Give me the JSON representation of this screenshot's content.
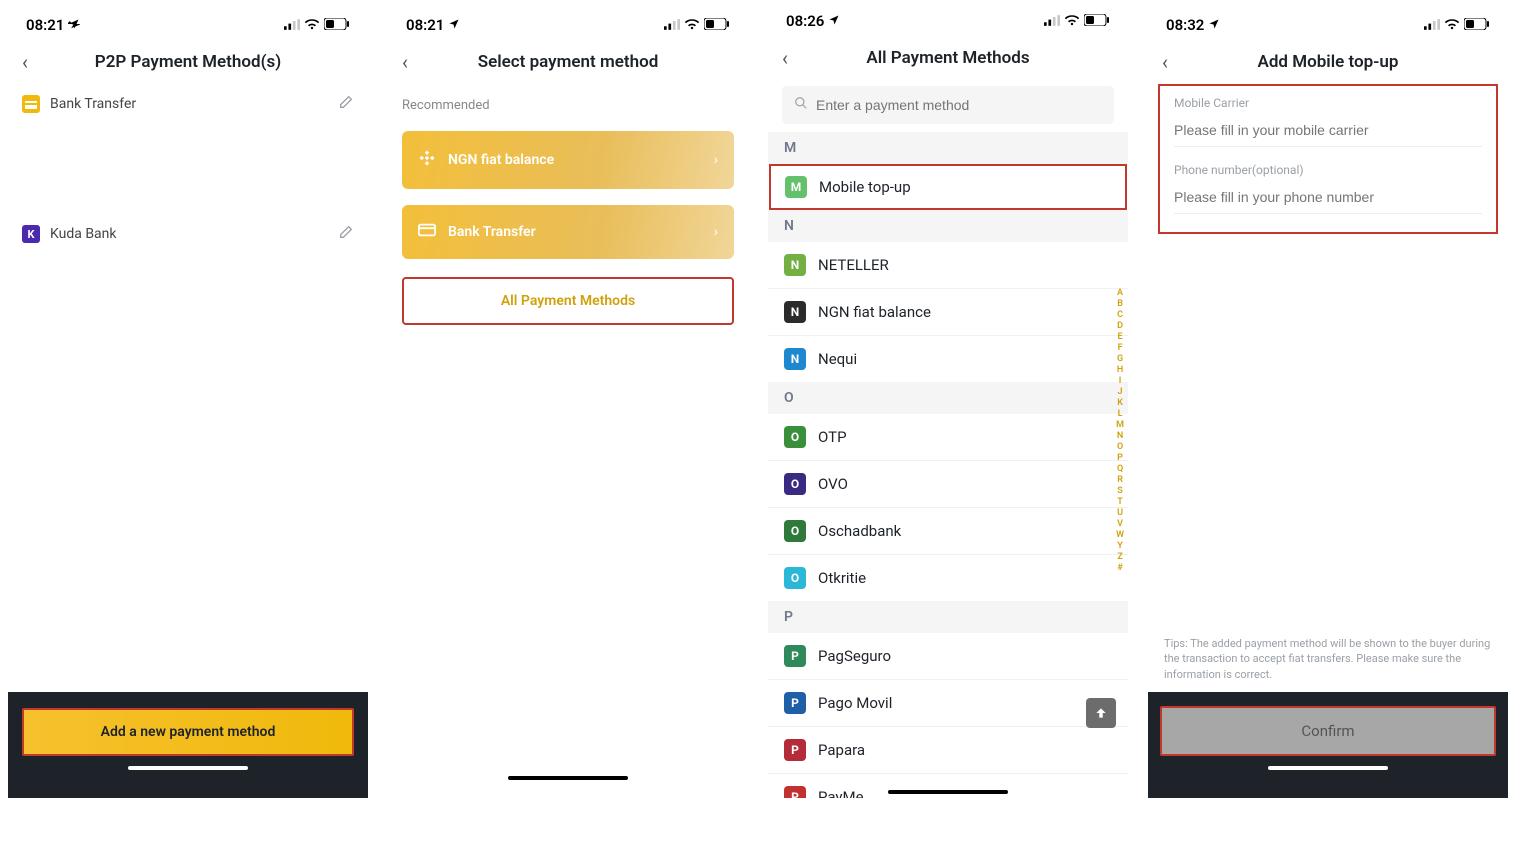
{
  "screen1": {
    "time": "08:21",
    "title": "P2P Payment Method(s)",
    "methods": [
      {
        "label": "Bank Transfer",
        "iconColor": "#f0b90b"
      },
      {
        "label": "Kuda Bank",
        "iconColor": "#4b2aad"
      }
    ],
    "add_button": "Add a new payment method"
  },
  "screen2": {
    "time": "08:21",
    "title": "Select payment method",
    "recommended_label": "Recommended",
    "cards": [
      {
        "label": "NGN fiat balance"
      },
      {
        "label": "Bank Transfer"
      }
    ],
    "all_label": "All Payment Methods"
  },
  "screen3": {
    "time": "08:26",
    "title": "All Payment Methods",
    "search_placeholder": "Enter a payment method",
    "sections": {
      "M": [
        {
          "label": "Mobile top-up",
          "color": "#63c06b",
          "highlight": true
        }
      ],
      "N": [
        {
          "label": "NETELLER",
          "color": "#72b043"
        },
        {
          "label": "NGN fiat balance",
          "color": "#2b2b2b"
        },
        {
          "label": "Nequi",
          "color": "#1e88cf"
        }
      ],
      "O": [
        {
          "label": "OTP",
          "color": "#3a8f3a"
        },
        {
          "label": "OVO",
          "color": "#3b2a82"
        },
        {
          "label": "Oschadbank",
          "color": "#2f7a3a"
        },
        {
          "label": "Otkritie",
          "color": "#2ab8d6"
        }
      ],
      "P": [
        {
          "label": "PagSeguro",
          "color": "#2f8a5b"
        },
        {
          "label": "Pago Movil",
          "color": "#1f5fa8"
        },
        {
          "label": "Papara",
          "color": "#b42b3a"
        },
        {
          "label": "PayMe",
          "color": "#c23030"
        }
      ]
    },
    "az": [
      "A",
      "B",
      "C",
      "D",
      "E",
      "F",
      "G",
      "H",
      "I",
      "J",
      "K",
      "L",
      "M",
      "N",
      "O",
      "P",
      "Q",
      "R",
      "S",
      "T",
      "U",
      "V",
      "W",
      "Y",
      "Z",
      "#"
    ]
  },
  "screen4": {
    "time": "08:32",
    "title": "Add Mobile top-up",
    "fields": [
      {
        "label": "Mobile Carrier",
        "placeholder": "Please fill in your mobile carrier"
      },
      {
        "label": "Phone number(optional)",
        "placeholder": "Please fill in your phone number"
      }
    ],
    "tips": "Tips: The added payment method will be shown to the buyer during the transaction to accept fiat transfers. Please make sure the information is correct.",
    "confirm": "Confirm"
  }
}
